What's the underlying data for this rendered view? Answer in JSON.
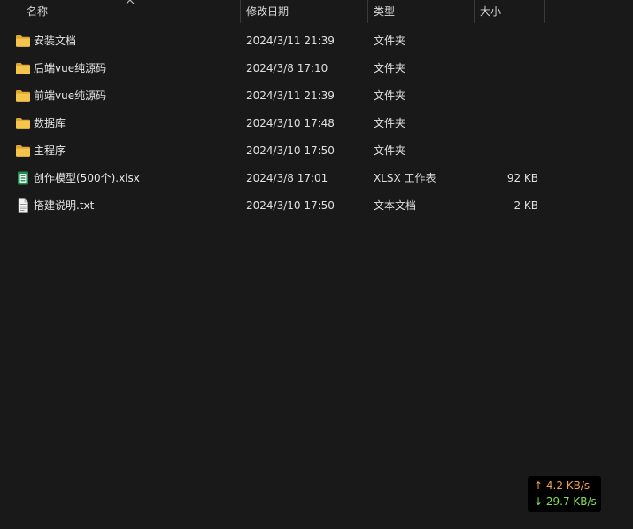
{
  "columns": {
    "name": "名称",
    "date": "修改日期",
    "type": "类型",
    "size": "大小"
  },
  "files": [
    {
      "icon": "folder-icon",
      "name": "安装文档",
      "date": "2024/3/11 21:39",
      "type": "文件夹",
      "size": ""
    },
    {
      "icon": "folder-icon",
      "name": "后端vue纯源码",
      "date": "2024/3/8 17:10",
      "type": "文件夹",
      "size": ""
    },
    {
      "icon": "folder-icon",
      "name": "前端vue纯源码",
      "date": "2024/3/11 21:39",
      "type": "文件夹",
      "size": ""
    },
    {
      "icon": "folder-icon",
      "name": "数据库",
      "date": "2024/3/10 17:48",
      "type": "文件夹",
      "size": ""
    },
    {
      "icon": "folder-icon",
      "name": "主程序",
      "date": "2024/3/10 17:50",
      "type": "文件夹",
      "size": ""
    },
    {
      "icon": "excel-file-icon",
      "name": "创作模型(500个).xlsx",
      "date": "2024/3/8 17:01",
      "type": "XLSX 工作表",
      "size": "92 KB"
    },
    {
      "icon": "text-file-icon",
      "name": "搭建说明.txt",
      "date": "2024/3/10 17:50",
      "type": "文本文档",
      "size": "2 KB"
    }
  ],
  "network": {
    "upload": "↑ 4.2 KB/s",
    "download": "↓ 29.7 KB/s"
  },
  "colors": {
    "background": "#191919",
    "folder": "#f2c144",
    "upload": "#f0a04a",
    "download": "#7ee05a"
  }
}
